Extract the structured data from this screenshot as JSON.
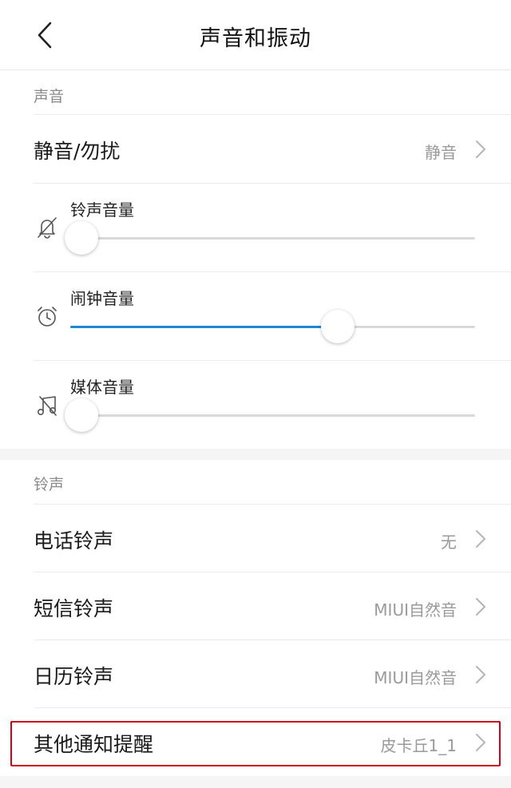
{
  "header": {
    "title": "声音和振动",
    "back_icon": "chevron-left-icon"
  },
  "sound_section": {
    "label": "声音",
    "mute_row": {
      "label": "静音/勿扰",
      "value": "静音"
    },
    "sliders": [
      {
        "label": "铃声音量",
        "icon": "bell-off-icon",
        "level": 0
      },
      {
        "label": "闹钟音量",
        "icon": "alarm-clock-icon",
        "level": 0.66
      },
      {
        "label": "媒体音量",
        "icon": "music-note-icon",
        "level": 0
      }
    ]
  },
  "ringtone_section": {
    "label": "铃声",
    "rows": [
      {
        "label": "电话铃声",
        "value": "无"
      },
      {
        "label": "短信铃声",
        "value": "MIUI自然音"
      },
      {
        "label": "日历铃声",
        "value": "MIUI自然音"
      },
      {
        "label": "其他通知提醒",
        "value": "皮卡丘1_1"
      }
    ]
  },
  "colors": {
    "accent": "#1e88d8",
    "highlight_border": "#d0021b",
    "section_gap": "#f5f5f5"
  }
}
